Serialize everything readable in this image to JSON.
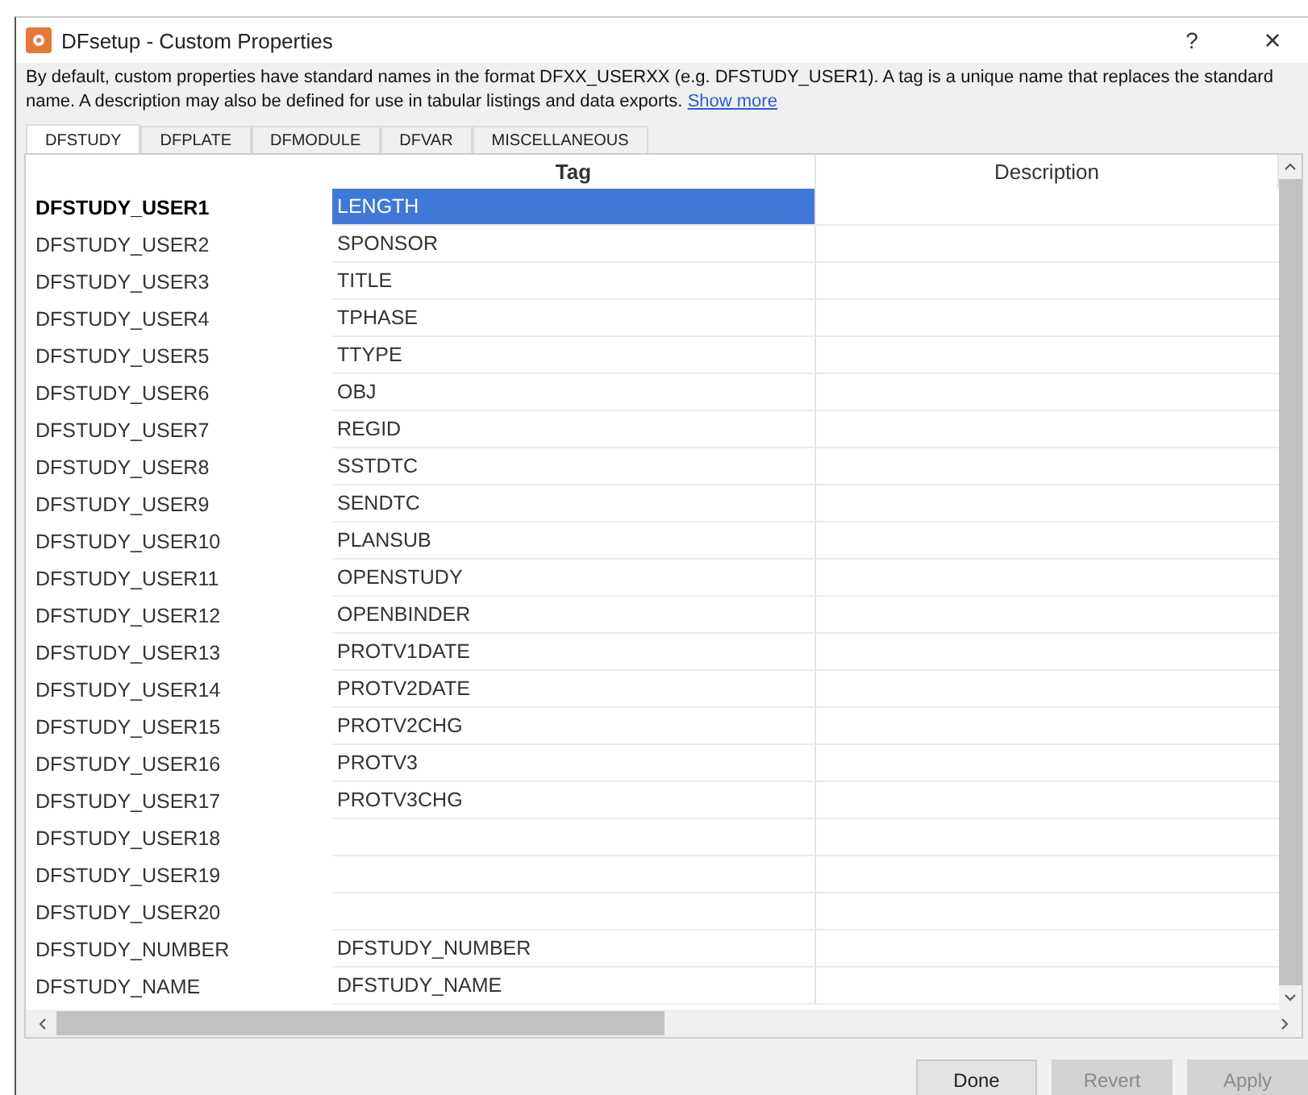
{
  "window": {
    "title": "DFsetup - Custom Properties",
    "help": "?",
    "close": "×"
  },
  "intro": {
    "text": "By default, custom properties have standard names in the format DFXX_USERXX (e.g. DFSTUDY_USER1). A tag is a unique name that replaces the standard name. A description may also be defined for use in tabular listings and data exports.",
    "link": "Show more"
  },
  "tabs": [
    {
      "label": "DFSTUDY",
      "selected": true
    },
    {
      "label": "DFPLATE",
      "selected": false
    },
    {
      "label": "DFMODULE",
      "selected": false
    },
    {
      "label": "DFVAR",
      "selected": false
    },
    {
      "label": "MISCELLANEOUS",
      "selected": false
    }
  ],
  "table": {
    "columns": [
      "Tag",
      "Description"
    ],
    "rows": [
      {
        "name": "DFSTUDY_USER1",
        "tag": "LENGTH",
        "selected": true
      },
      {
        "name": "DFSTUDY_USER2",
        "tag": "SPONSOR",
        "selected": false
      },
      {
        "name": "DFSTUDY_USER3",
        "tag": "TITLE",
        "selected": false
      },
      {
        "name": "DFSTUDY_USER4",
        "tag": "TPHASE",
        "selected": false
      },
      {
        "name": "DFSTUDY_USER5",
        "tag": "TTYPE",
        "selected": false
      },
      {
        "name": "DFSTUDY_USER6",
        "tag": "OBJ",
        "selected": false
      },
      {
        "name": "DFSTUDY_USER7",
        "tag": "REGID",
        "selected": false
      },
      {
        "name": "DFSTUDY_USER8",
        "tag": "SSTDTC",
        "selected": false
      },
      {
        "name": "DFSTUDY_USER9",
        "tag": "SENDTC",
        "selected": false
      },
      {
        "name": "DFSTUDY_USER10",
        "tag": "PLANSUB",
        "selected": false
      },
      {
        "name": "DFSTUDY_USER11",
        "tag": "OPENSTUDY",
        "selected": false
      },
      {
        "name": "DFSTUDY_USER12",
        "tag": "OPENBINDER",
        "selected": false
      },
      {
        "name": "DFSTUDY_USER13",
        "tag": "PROTV1DATE",
        "selected": false
      },
      {
        "name": "DFSTUDY_USER14",
        "tag": "PROTV2DATE",
        "selected": false
      },
      {
        "name": "DFSTUDY_USER15",
        "tag": "PROTV2CHG",
        "selected": false
      },
      {
        "name": "DFSTUDY_USER16",
        "tag": "PROTV3",
        "selected": false
      },
      {
        "name": "DFSTUDY_USER17",
        "tag": "PROTV3CHG",
        "selected": false
      },
      {
        "name": "DFSTUDY_USER18",
        "selected": false
      },
      {
        "name": "DFSTUDY_USER19",
        "selected": false
      },
      {
        "name": "DFSTUDY_USER20",
        "selected": false
      },
      {
        "name": "DFSTUDY_NUMBER",
        "tag": "DFSTUDY_NUMBER",
        "selected": false
      },
      {
        "name": "DFSTUDY_NAME",
        "tag": "DFSTUDY_NAME",
        "selected": false
      }
    ]
  },
  "buttons": [
    {
      "label": "Done",
      "disabled": false
    },
    {
      "label": "Revert",
      "disabled": true
    },
    {
      "label": "Apply",
      "disabled": true
    }
  ]
}
